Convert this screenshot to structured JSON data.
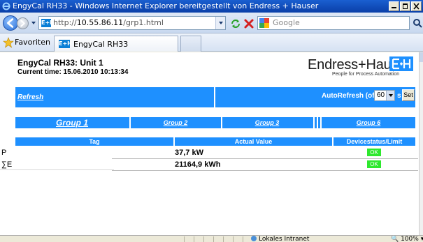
{
  "window": {
    "title": "EngyCal RH33 - Windows Internet Explorer bereitgestellt von Endress + Hauser"
  },
  "address_bar": {
    "url_prefix": "http://",
    "url_host": "10.55.86.11",
    "url_path": "/grp1.html"
  },
  "search": {
    "provider": "Google"
  },
  "favorites_bar": {
    "label": "Favoriten",
    "tab_title": "EngyCal RH33",
    "tab_icon_text": "E+H"
  },
  "page": {
    "title": "EngyCal RH33: Unit 1",
    "current_time": "Current time: 15.06.2010 10:13:34",
    "logo_text": "Endress+Hauser",
    "logo_tagline": "People for Process Automation",
    "refresh_link": "Refresh",
    "autorefresh_label": "AutoRefresh (off):",
    "autorefresh_value": "60",
    "autorefresh_unit": "s",
    "set_button": "Set",
    "groups": [
      "Group 1",
      "Group 2",
      "Group 3",
      "Group 6"
    ],
    "table_headers": {
      "tag": "Tag",
      "actual_value": "Actual Value",
      "status": "Devicestatus/Limit"
    },
    "rows": [
      {
        "tag": "P",
        "value": "37,7 kW",
        "status": "OK"
      },
      {
        "tag": "∑E",
        "value": "21164,9 kWh",
        "status": "OK"
      }
    ]
  },
  "status_bar": {
    "zone": "Lokales Intranet",
    "zoom": "100%"
  },
  "colors": {
    "accent_blue": "#1e90ff",
    "status_ok": "#2ee82e",
    "title_bar": "#0a3fa8"
  }
}
